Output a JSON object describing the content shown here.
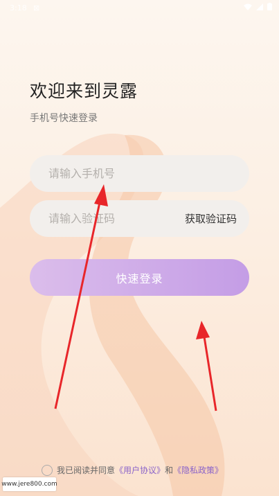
{
  "status_bar": {
    "time": "3:18",
    "notif": "⊠"
  },
  "header": {
    "title": "欢迎来到灵露",
    "subtitle": "手机号快速登录"
  },
  "form": {
    "phone_placeholder": "请输入手机号",
    "code_placeholder": "请输入验证码",
    "get_code_label": "获取验证码",
    "login_label": "快速登录"
  },
  "agreement": {
    "prefix": "我已阅读并同意",
    "user_agreement": "《用户协议》",
    "and": "和",
    "privacy_policy": "《隐私政策》"
  },
  "watermark": "www.jere800.com",
  "colors": {
    "accent": "#c49de6",
    "link": "#8a63c9",
    "arrow": "#e8262a"
  }
}
